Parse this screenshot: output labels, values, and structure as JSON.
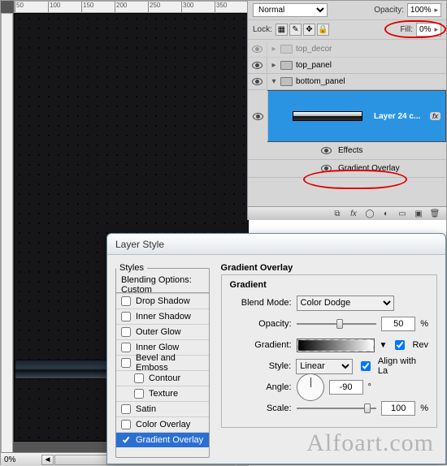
{
  "ruler": {
    "marks": [
      "50",
      "100",
      "150",
      "200",
      "250",
      "300",
      "350"
    ]
  },
  "zoom": "0%",
  "layers_panel": {
    "blend_mode": "Normal",
    "opacity_label": "Opacity:",
    "opacity": "100%",
    "lock_label": "Lock:",
    "fill_label": "Fill:",
    "fill": "0%",
    "rows": [
      {
        "name": "top_decor"
      },
      {
        "name": "top_panel"
      },
      {
        "name": "bottom_panel"
      }
    ],
    "big_layer": "Layer 24 c...",
    "fx_label": "fx",
    "effects_label": "Effects",
    "effect_item": "Gradient Overlay"
  },
  "dialog": {
    "title": "Layer Style",
    "styles_legend": "Styles",
    "styles": [
      "Blending Options: Custom",
      "Drop Shadow",
      "Inner Shadow",
      "Outer Glow",
      "Inner Glow",
      "Bevel and Emboss",
      "Contour",
      "Texture",
      "Satin",
      "Color Overlay",
      "Gradient Overlay"
    ],
    "section_title": "Gradient Overlay",
    "sub_title": "Gradient",
    "blend_mode_label": "Blend Mode:",
    "blend_mode": "Color Dodge",
    "opacity_label": "Opacity:",
    "opacity": "50",
    "perc": "%",
    "gradient_label": "Gradient:",
    "reverse_label": "Rev",
    "style_label": "Style:",
    "style": "Linear",
    "align_label": "Align with La",
    "angle_label": "Angle:",
    "angle": "-90",
    "deg": "°",
    "scale_label": "Scale:",
    "scale": "100"
  },
  "watermark": "Alfoart.com"
}
